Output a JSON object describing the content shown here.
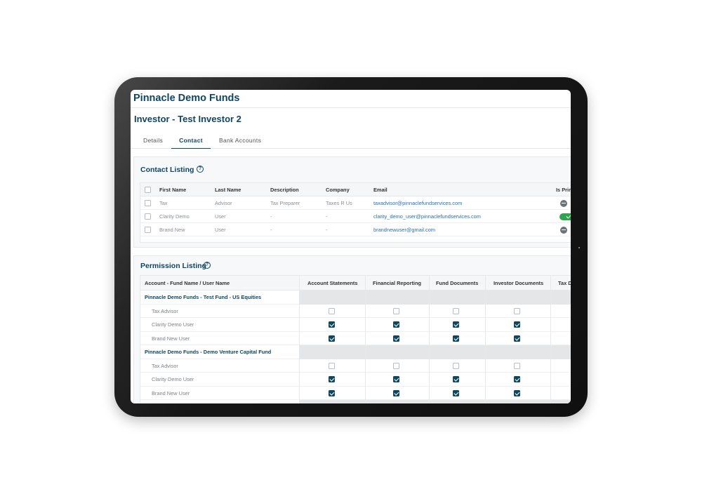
{
  "app": {
    "brand": "Pinnacle Demo Funds"
  },
  "page": {
    "title": "Investor - Test Investor 2"
  },
  "tabs": [
    {
      "label": "Details",
      "active": false
    },
    {
      "label": "Contact",
      "active": true
    },
    {
      "label": "Bank Accounts",
      "active": false
    }
  ],
  "contact_listing": {
    "title": "Contact Listing",
    "help_icon": "question-circle-icon",
    "columns": [
      "First Name",
      "Last Name",
      "Description",
      "Company",
      "Email",
      "Is Prim"
    ],
    "rows": [
      {
        "first": "Tax",
        "last": "Advisor",
        "description": "Tax Preparer",
        "company": "Taxes R Us",
        "email": "taxadvisor@pinnaclefundservices.com",
        "is_primary": false
      },
      {
        "first": "Clarity Demo",
        "last": "User",
        "description": "-",
        "company": "-",
        "email": "clarity_demo_user@pinnaclefundservices.com",
        "is_primary": true
      },
      {
        "first": "Brand New",
        "last": "User",
        "description": "-",
        "company": "-",
        "email": "brandnewuser@gmail.com",
        "is_primary": false
      }
    ]
  },
  "permission_listing": {
    "title": "Permission Listing",
    "help_icon": "question-circle-icon",
    "columns": [
      "Account - Fund Name / User Name",
      "Account Statements",
      "Financial Reporting",
      "Fund Documents",
      "Investor Documents",
      "Tax D"
    ],
    "funds": [
      {
        "name": "Pinnacle Demo Funds - Test Fund - US Equities",
        "users": [
          {
            "name": "Tax Advisor",
            "perms": [
              false,
              false,
              false,
              false
            ]
          },
          {
            "name": "Clarity Demo User",
            "perms": [
              true,
              true,
              true,
              true
            ]
          },
          {
            "name": "Brand New User",
            "perms": [
              true,
              true,
              true,
              true
            ]
          }
        ]
      },
      {
        "name": "Pinnacle Demo Funds - Demo Venture Capital Fund",
        "users": [
          {
            "name": "Tax Advisor",
            "perms": [
              false,
              false,
              false,
              false
            ]
          },
          {
            "name": "Clarity Demo User",
            "perms": [
              true,
              true,
              true,
              true
            ]
          },
          {
            "name": "Brand New User",
            "perms": [
              true,
              true,
              true,
              true
            ]
          }
        ]
      }
    ]
  },
  "colors": {
    "brand": "#0f4660",
    "link": "#2a6fb0",
    "toggle_on": "#2ea44f"
  }
}
